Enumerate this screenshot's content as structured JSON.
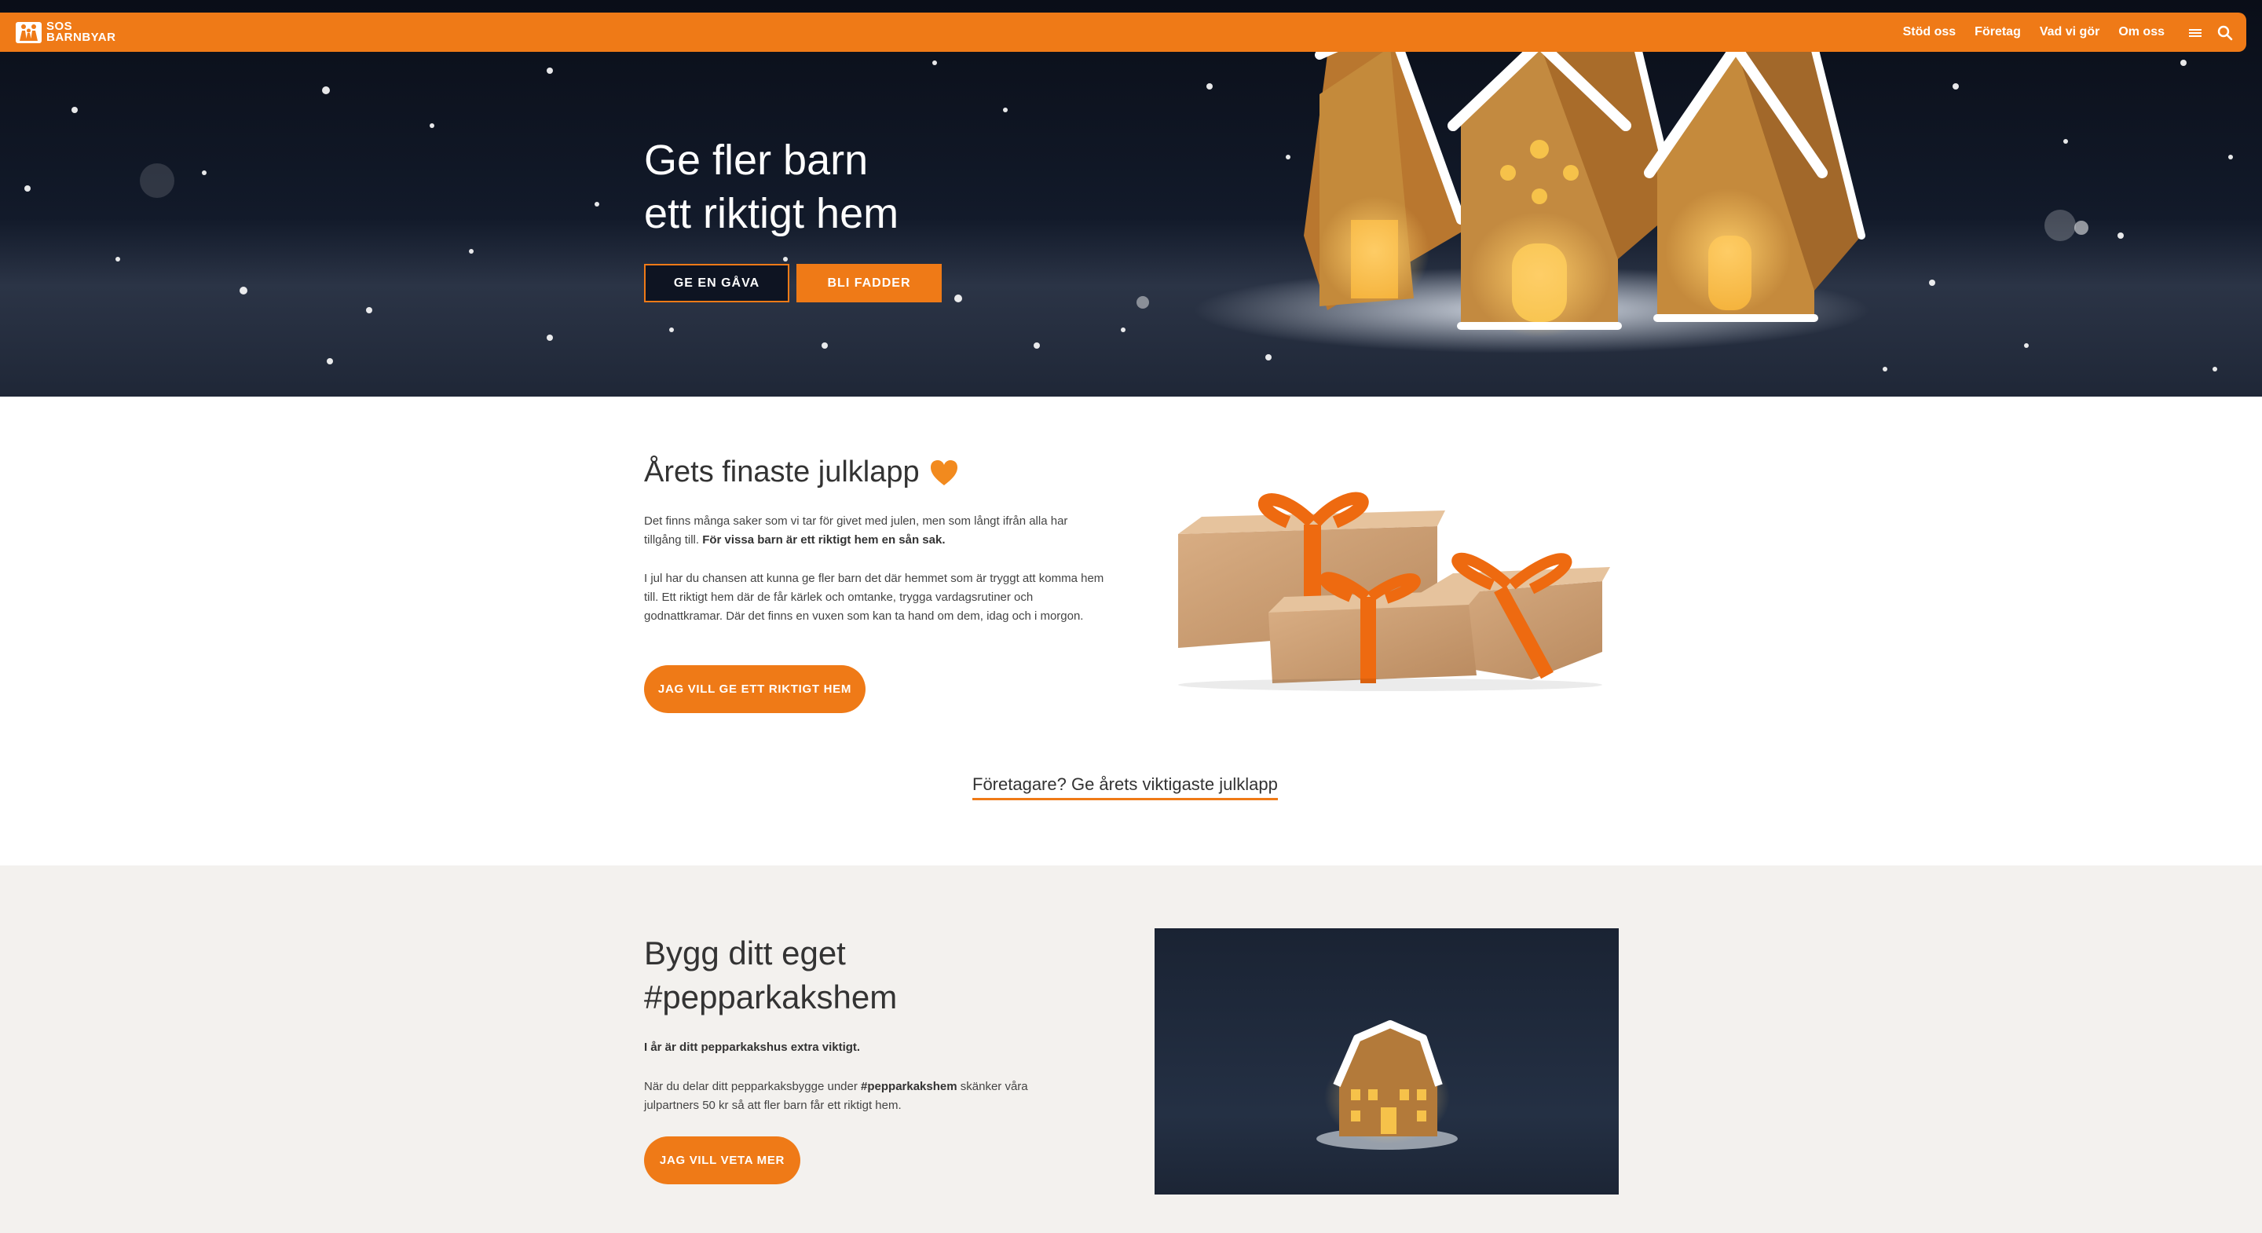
{
  "nav": {
    "logo_line1": "SOS",
    "logo_line2": "BARNBYAR",
    "links": [
      "Stöd oss",
      "Företag",
      "Vad vi gör",
      "Om oss"
    ],
    "icons": [
      "menu-icon",
      "search-icon"
    ]
  },
  "hero": {
    "title_line1": "Ge fler barn",
    "title_line2": "ett riktigt hem",
    "button_gift": "GE EN GÅVA",
    "button_sponsor": "BLI FADDER"
  },
  "gift_section": {
    "title": "Årets finaste julklapp",
    "p1_text": "Det finns många saker som vi tar för givet med julen, men som långt ifrån alla har tillgång till. ",
    "p1_bold": "För vissa barn är ett riktigt hem en sån sak.",
    "p2": "I jul har du chansen att kunna ge fler barn det där hemmet som är tryggt att komma hem till. Ett riktigt hem där de får kärlek och omtanke, trygga vardagsrutiner och godnattkramar. Där det finns en vuxen som kan ta hand om dem, idag och i morgon.",
    "cta": "JAG VILL GE ETT RIKTIGT HEM",
    "business_link": "Företagare? Ge årets viktigaste julklapp"
  },
  "build_section": {
    "title_line1": "Bygg ditt eget",
    "title_line2": "#pepparkakshem",
    "lead": "I år är ditt pepparkakshus extra viktigt.",
    "p_before": "När du delar ditt pepparkaksbygge under ",
    "p_bold": "#pepparkakshem",
    "p_after": " skänker våra julpartners 50 kr så att fler barn får ett riktigt hem.",
    "cta": "JAG VILL VETA MER"
  },
  "colors": {
    "accent": "#EF7A17",
    "text": "#333333",
    "section_bg": "#F3F1EE"
  }
}
